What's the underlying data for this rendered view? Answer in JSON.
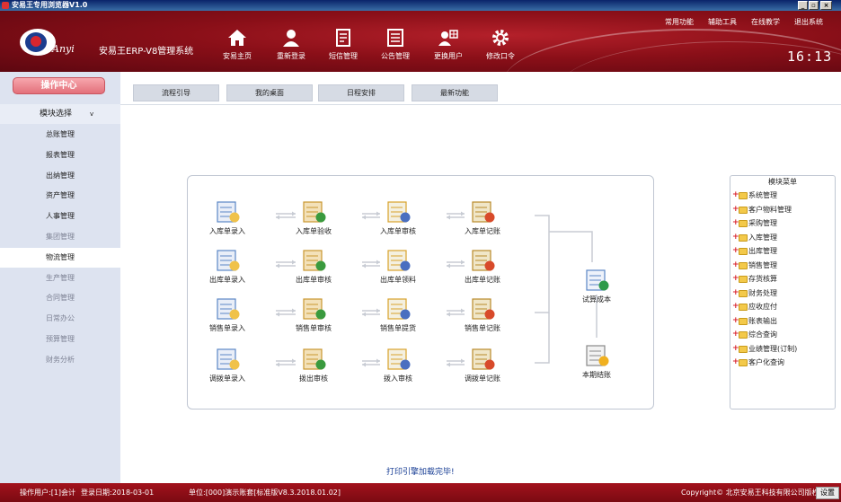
{
  "window": {
    "title": "安易王专用浏览器V1.0"
  },
  "header": {
    "brand": "Anyi",
    "system_name": "安易王ERP-V8管理系统",
    "nav": [
      {
        "label": "安易主页",
        "icon": "home-icon"
      },
      {
        "label": "重新登录",
        "icon": "user-login-icon"
      },
      {
        "label": "短信管理",
        "icon": "sms-icon"
      },
      {
        "label": "公告管理",
        "icon": "notice-icon"
      },
      {
        "label": "更换用户",
        "icon": "switch-user-icon"
      },
      {
        "label": "修改口令",
        "icon": "gear-icon"
      }
    ],
    "links": [
      "常用功能",
      "辅助工具",
      "在线教学",
      "退出系统"
    ],
    "clock": "16:13"
  },
  "sidebar": {
    "op_center": "操作中心",
    "module_select": "模块选择",
    "module_select_arrow": "v",
    "items": [
      {
        "label": "总账管理",
        "state": "normal"
      },
      {
        "label": "报表管理",
        "state": "normal"
      },
      {
        "label": "出纳管理",
        "state": "normal"
      },
      {
        "label": "资产管理",
        "state": "normal"
      },
      {
        "label": "人事管理",
        "state": "normal"
      },
      {
        "label": "集团管理",
        "state": "dim"
      },
      {
        "label": "物流管理",
        "state": "active"
      },
      {
        "label": "生产管理",
        "state": "dim"
      },
      {
        "label": "合同管理",
        "state": "dim"
      },
      {
        "label": "日常办公",
        "state": "dim"
      },
      {
        "label": "预算管理",
        "state": "dim"
      },
      {
        "label": "财务分析",
        "state": "dim"
      }
    ]
  },
  "tabs": [
    "流程引导",
    "我的桌面",
    "日程安排",
    "最新功能"
  ],
  "flow": {
    "rows": [
      [
        "入库单录入",
        "入库单验收",
        "入库单审核",
        "入库单记账"
      ],
      [
        "出库单录入",
        "出库单审核",
        "出库单领料",
        "出库单记账"
      ],
      [
        "销售单录入",
        "销售单审核",
        "销售单提货",
        "销售单记账"
      ],
      [
        "调拨单录入",
        "拨出审核",
        "拨入审核",
        "调拨单记账"
      ]
    ],
    "right": [
      "试算成本",
      "本期结账"
    ]
  },
  "module_menu": {
    "title": "模块菜单",
    "items": [
      "系统管理",
      "客户物料管理",
      "采购管理",
      "入库管理",
      "出库管理",
      "销售管理",
      "存货核算",
      "财务处理",
      "应收应付",
      "账表输出",
      "综合查询",
      "业绩管理(订制)",
      "客户化查询"
    ]
  },
  "print_message": "打印引擎加载完毕!",
  "status": {
    "operator": "操作用户:[1]会计",
    "login_date": "登录日期:2018-03-01",
    "unit": "单位:[000]演示账套[标准版V8.3.2018.01.02]",
    "copyright": "Copyright© 北京安易王科技有限公司版权",
    "settings": "设置"
  }
}
